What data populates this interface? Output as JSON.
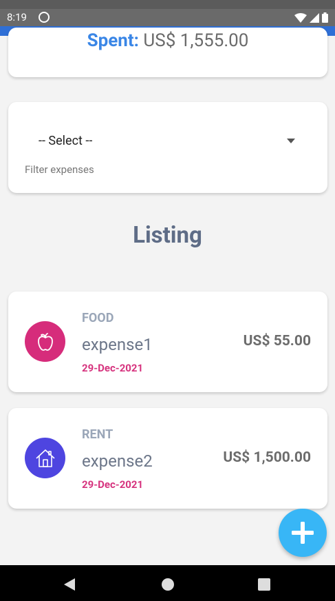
{
  "status_bar": {
    "time": "8:19"
  },
  "summary": {
    "spent_label": "Spent:",
    "spent_value": "US$ 1,555.00"
  },
  "filter": {
    "selected": "-- Select --",
    "label": "Filter expenses"
  },
  "listing": {
    "heading": "Listing"
  },
  "expenses": [
    {
      "category": "FOOD",
      "name": "expense1",
      "date": "29-Dec-2021",
      "amount": "US$ 55.00",
      "icon": "apple-icon",
      "icon_color": "#d62c7b"
    },
    {
      "category": "RENT",
      "name": "expense2",
      "date": "29-Dec-2021",
      "amount": "US$ 1,500.00",
      "icon": "house-icon",
      "icon_color": "#4e45e0"
    }
  ],
  "fab": {
    "icon": "plus-icon",
    "color": "#38b6f6"
  }
}
